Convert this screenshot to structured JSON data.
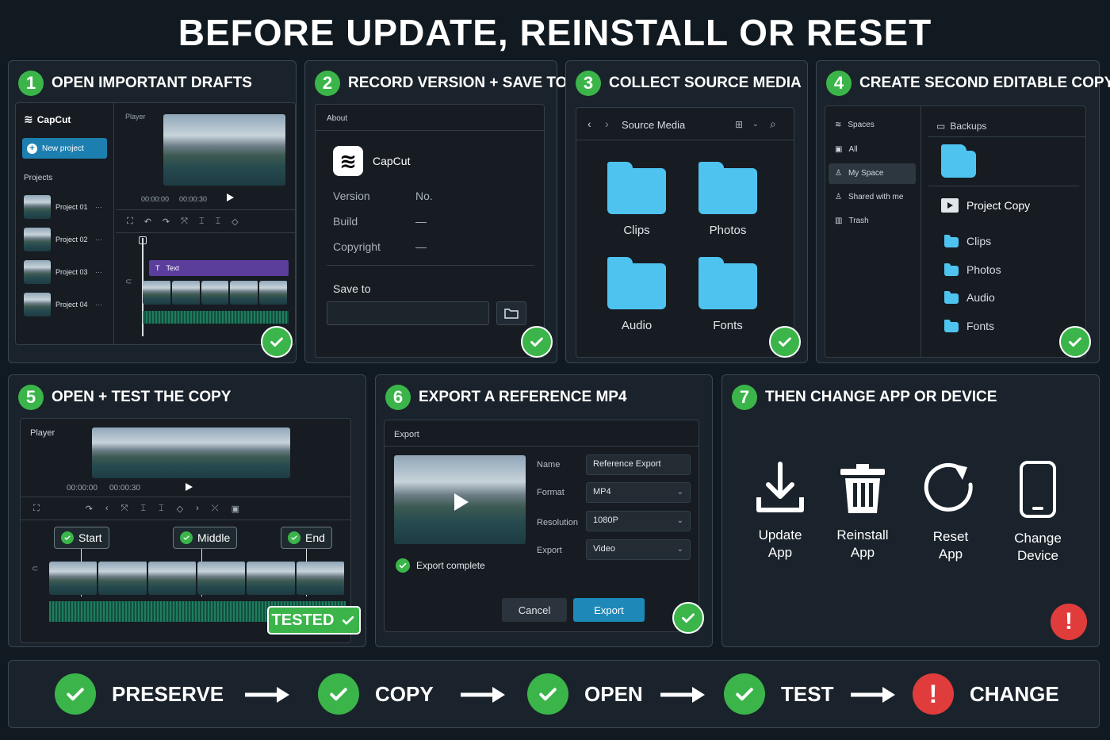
{
  "title": "BEFORE UPDATE, REINSTALL OR RESET",
  "steps": [
    {
      "num": "1",
      "title": "OPEN IMPORTANT DRAFTS"
    },
    {
      "num": "2",
      "title": "RECORD VERSION + SAVE TO"
    },
    {
      "num": "3",
      "title": "COLLECT SOURCE MEDIA"
    },
    {
      "num": "4",
      "title": "CREATE SECOND EDITABLE COPY"
    },
    {
      "num": "5",
      "title": "OPEN + TEST THE COPY"
    },
    {
      "num": "6",
      "title": "EXPORT A REFERENCE MP4"
    },
    {
      "num": "7",
      "title": "THEN CHANGE APP OR DEVICE"
    }
  ],
  "p1": {
    "app": "CapCut",
    "new_project": "New project",
    "projects_label": "Projects",
    "projects": [
      "Project 01",
      "Project 02",
      "Project 03",
      "Project 04"
    ],
    "player": "Player",
    "time_start": "00:00:00",
    "time_end": "00:00:30",
    "text_clip": "Text"
  },
  "p2": {
    "about": "About",
    "app": "CapCut",
    "rows": [
      {
        "label": "Version",
        "value": "No."
      },
      {
        "label": "Build",
        "value": "—"
      },
      {
        "label": "Copyright",
        "value": "—"
      }
    ],
    "save_to": "Save to"
  },
  "p3": {
    "header": "Source Media",
    "folders": [
      "Clips",
      "Photos",
      "Audio",
      "Fonts"
    ]
  },
  "p4": {
    "nav": [
      "Spaces",
      "All",
      "My Space",
      "Shared with me",
      "Trash"
    ],
    "backups": "Backups",
    "project": "Project Copy",
    "folders": [
      "Clips",
      "Photos",
      "Audio",
      "Fonts"
    ]
  },
  "p5": {
    "player": "Player",
    "time_start": "00:00:00",
    "time_end": "00:00:30",
    "markers": [
      "Start",
      "Middle",
      "End"
    ],
    "tested": "TESTED"
  },
  "p6": {
    "export_title": "Export",
    "fields": [
      {
        "label": "Name",
        "value": "Reference Export"
      },
      {
        "label": "Format",
        "value": "MP4"
      },
      {
        "label": "Resolution",
        "value": "1080P"
      },
      {
        "label": "Export",
        "value": "Video"
      }
    ],
    "complete": "Export complete",
    "cancel": "Cancel",
    "export_btn": "Export"
  },
  "p7": {
    "actions": [
      {
        "line1": "Update",
        "line2": "App",
        "icon": "download-icon"
      },
      {
        "line1": "Reinstall",
        "line2": "App",
        "icon": "trash-icon"
      },
      {
        "line1": "Reset",
        "line2": "App",
        "icon": "reset-icon"
      },
      {
        "line1": "Change",
        "line2": "Device",
        "icon": "phone-icon"
      }
    ]
  },
  "flow": [
    "PRESERVE",
    "COPY",
    "OPEN",
    "TEST",
    "CHANGE"
  ],
  "colors": {
    "accent_green": "#3bb54a",
    "folder_blue": "#4fc3f0",
    "alert_red": "#e03c3c",
    "export_button": "#1e88b8"
  }
}
